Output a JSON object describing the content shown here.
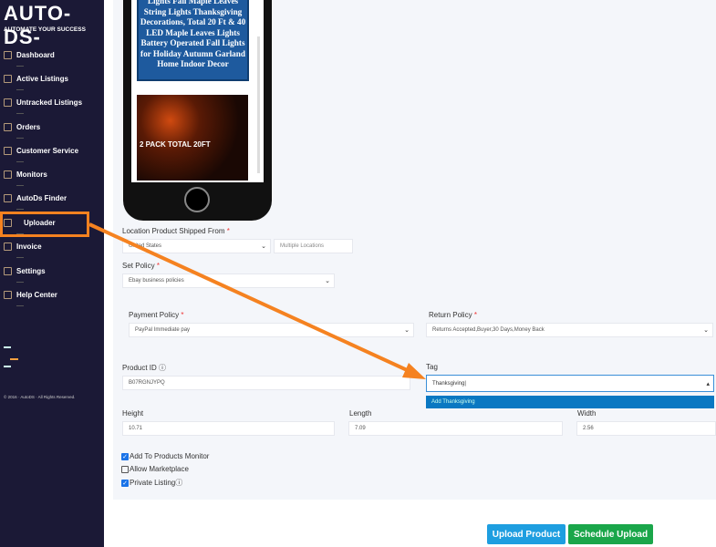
{
  "sidebar": {
    "logo": "AUTO-DS-",
    "tagline": "AUTOMATE YOUR SUCCESS",
    "items": [
      {
        "label": "Dashboard",
        "icon": "dashboard-icon"
      },
      {
        "label": "Active Listings",
        "icon": "list-icon"
      },
      {
        "label": "Untracked Listings",
        "icon": "list-icon"
      },
      {
        "label": "Orders",
        "icon": "orders-icon"
      },
      {
        "label": "Customer Service",
        "icon": "heart-icon"
      },
      {
        "label": "Monitors",
        "icon": "sliders-icon"
      },
      {
        "label": "AutoDs Finder",
        "icon": "search-icon"
      },
      {
        "label": "Uploader",
        "icon": "cloud-upload-icon",
        "active": true
      },
      {
        "label": "Invoice",
        "icon": "invoice-icon"
      },
      {
        "label": "Settings",
        "icon": "settings-icon"
      },
      {
        "label": "Help Center",
        "icon": "lifebuoy-icon"
      }
    ],
    "copyright": "© 2016 · AutoDS · All Rights Reserved."
  },
  "preview": {
    "title": "Lights Fall Maple Leaves String Lights Thanksgiving Decorations, Total 20 Ft & 40 LED Maple Leaves Lights Battery Operated Fall Lights for Holiday Autumn Garland Home Indoor Decor",
    "image_text": "2 PACK TOTAL 20FT"
  },
  "form": {
    "location": {
      "label": "Location Product Shipped From",
      "country": "United States",
      "multi_placeholder": "Multiple Locations"
    },
    "set_policy": {
      "label": "Set Policy",
      "value": "Ebay business policies"
    },
    "payment_policy": {
      "label": "Payment Policy",
      "value": "PayPal Immediate pay"
    },
    "return_policy": {
      "label": "Return Policy",
      "value": "Returns Accepted,Buyer,30 Days,Money Back"
    },
    "product_id": {
      "label": "Product ID",
      "value": "B07RGNJYPQ"
    },
    "tag": {
      "label": "Tag",
      "value": "Thanksgiving",
      "option": "Add Thanksgiving"
    },
    "height": {
      "label": "Height",
      "value": "10.71"
    },
    "length": {
      "label": "Length",
      "value": "7.09"
    },
    "width": {
      "label": "Width",
      "value": "2.56"
    },
    "checkboxes": [
      {
        "label": "Add To Products Monitor",
        "checked": true
      },
      {
        "label": "Allow Marketplace",
        "checked": false
      },
      {
        "label": "Private Listing",
        "checked": true
      }
    ],
    "upload_button": "Upload Product",
    "schedule_button": "Schedule Upload"
  },
  "colors": {
    "sidebar": "#1b1936",
    "highlight": "#f58220",
    "upload": "#1e9ee0",
    "schedule": "#1aa64a",
    "dropdown": "#0a78c2"
  }
}
